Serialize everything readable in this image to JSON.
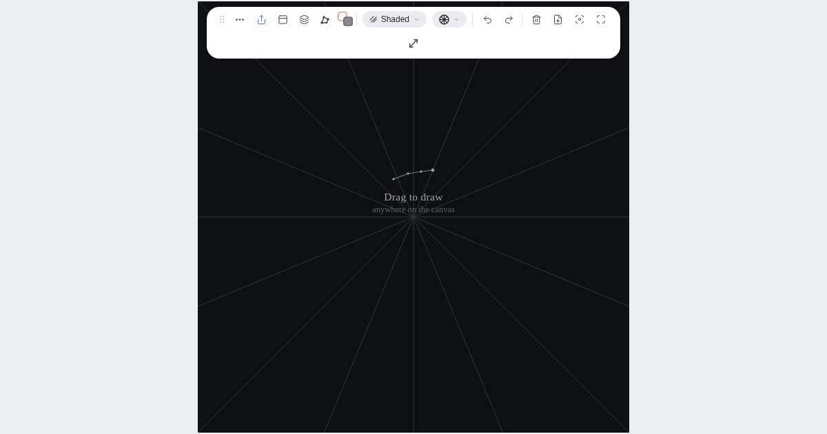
{
  "toolbar": {
    "shading_select": {
      "label": "Shaded"
    }
  },
  "canvas": {
    "hint": {
      "title": "Drag to draw",
      "subtitle": "anywhere on the canvas"
    }
  }
}
